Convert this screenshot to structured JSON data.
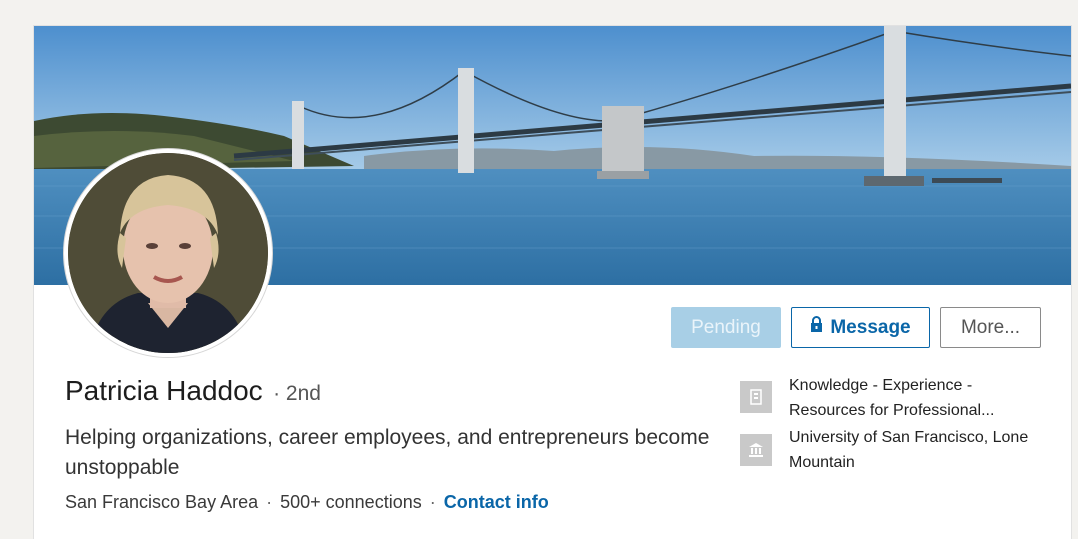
{
  "profile": {
    "name": "Patricia Haddoc",
    "degree": "· 2nd",
    "headline": "Helping organizations, career employees, and entrepreneurs become unstoppable",
    "location": "San Francisco Bay Area",
    "connections": "500+ connections",
    "contact_label": "Contact info"
  },
  "actions": {
    "pending_label": "Pending",
    "message_label": "Message",
    "more_label": "More..."
  },
  "sidebar": {
    "company": "Knowledge - Experience - Resources for Professional...",
    "school": "University of San Francisco, Lone Mountain"
  },
  "colors": {
    "accent": "#0a66a8",
    "pending_bg": "#a8cfe6",
    "sky": "#5d9fd6",
    "water": "#3a7fb3"
  },
  "icons": {
    "company": "building-icon",
    "school": "school-icon",
    "message": "lock-icon"
  }
}
